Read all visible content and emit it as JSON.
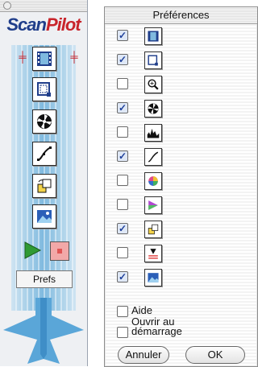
{
  "pilot": {
    "logo_left": "Scan",
    "logo_right": "Pilot",
    "tools": [
      "film-strip-icon",
      "crop-frame-icon",
      "aperture-icon",
      "curve-icon",
      "flip-icon",
      "image-icon"
    ],
    "prefs_label": "Prefs"
  },
  "prefs": {
    "title": "Préférences",
    "items": [
      {
        "icon": "film-strip-icon",
        "checked": true
      },
      {
        "icon": "crop-frame-icon",
        "checked": true
      },
      {
        "icon": "magnifier-icon",
        "checked": false
      },
      {
        "icon": "aperture-icon",
        "checked": true
      },
      {
        "icon": "histogram-icon",
        "checked": false
      },
      {
        "icon": "curve-icon",
        "checked": true
      },
      {
        "icon": "color-wheel-icon",
        "checked": false
      },
      {
        "icon": "color-triangle-icon",
        "checked": false
      },
      {
        "icon": "flip-icon",
        "checked": true
      },
      {
        "icon": "level-icon",
        "checked": false
      },
      {
        "icon": "image-icon",
        "checked": true
      }
    ],
    "aide_label": "Aide",
    "startup_label_1": "Ouvrir au",
    "startup_label_2": "démarrage",
    "cancel_label": "Annuler",
    "ok_label": "OK"
  },
  "colors": {
    "checkmark": "#1d3f9a",
    "logo_blue": "#1f3d8a",
    "logo_red": "#c8242b",
    "beam": "#7fb9df"
  }
}
